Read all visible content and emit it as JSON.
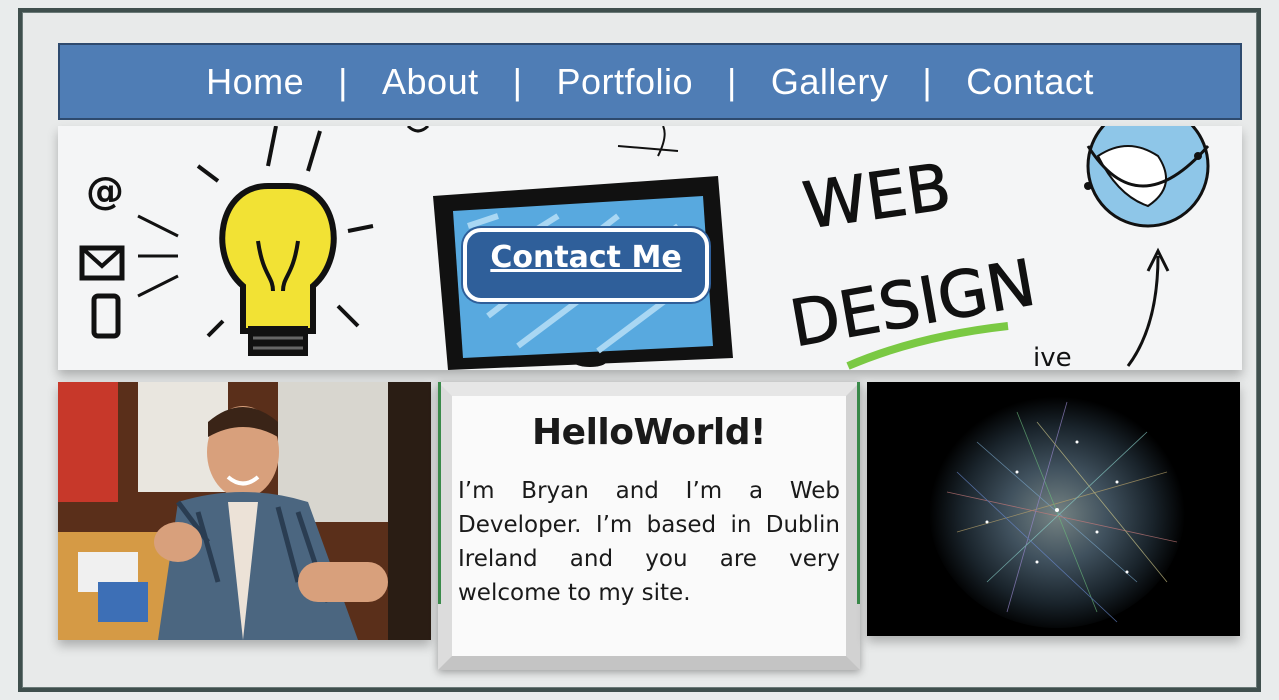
{
  "nav": {
    "items": [
      {
        "label": "Home"
      },
      {
        "label": "About"
      },
      {
        "label": "Portfolio"
      },
      {
        "label": "Gallery"
      },
      {
        "label": "Contact"
      }
    ],
    "separator": "|",
    "color": "#4f7db5"
  },
  "banner": {
    "cta_label": "Contact Me",
    "cta_color": "#2f5f9a"
  },
  "intro": {
    "heading": "HelloWorld!",
    "body": "I’m Bryan and I’m a Web Developer. I’m based in Dublin Ireland and you are very welcome to my site."
  },
  "images": {
    "photo": "person-photo",
    "banner": "web-design-illustration",
    "network": "network-visualization"
  }
}
